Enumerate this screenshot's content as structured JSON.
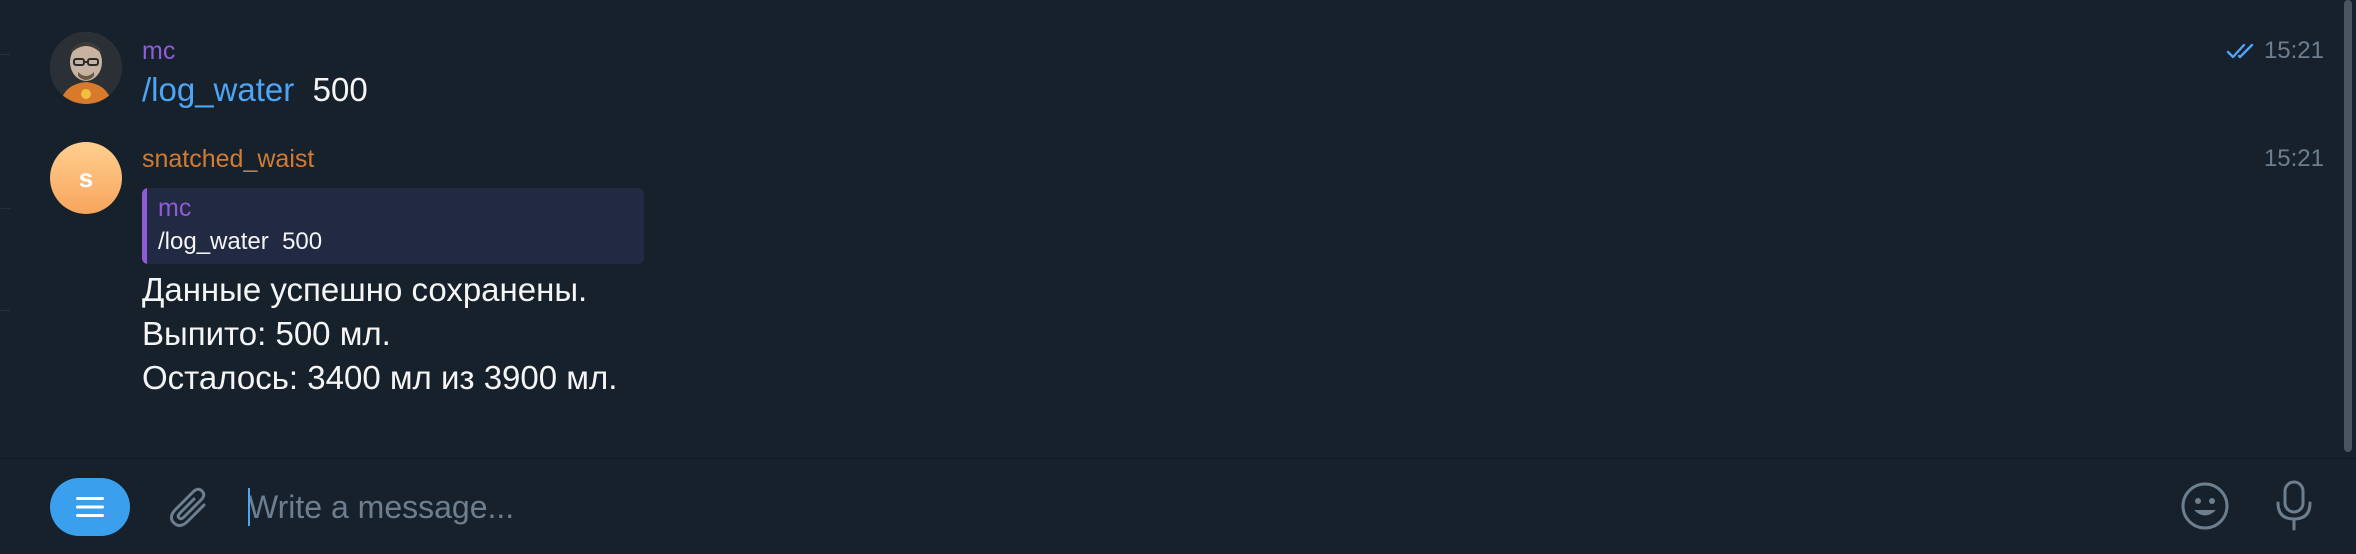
{
  "messages": [
    {
      "sender": "mc",
      "time": "15:21",
      "status": "read",
      "command": "/log_water",
      "argument": "500",
      "avatar": "photo"
    },
    {
      "sender": "snatched_waist",
      "time": "15:21",
      "avatar_letter": "s",
      "reply": {
        "sender": "mc",
        "text": "/log_water  500"
      },
      "lines": [
        "Данные успешно сохранены.",
        "Выпито: 500 мл.",
        "Осталось: 3400 мл из 3900 мл."
      ]
    }
  ],
  "composer": {
    "placeholder": "Write a message...",
    "value": "",
    "menu_icon": "menu-icon",
    "attach_icon": "paperclip-icon",
    "emoji_icon": "emoji-icon",
    "mic_icon": "microphone-icon"
  },
  "colors": {
    "background": "#17212b",
    "accent": "#3aa0ed",
    "command": "#4ea4f5",
    "sender_mc": "#8e5cd6",
    "sender_bot": "#d27c33",
    "reply_bg": "#222942",
    "muted": "#6d7f8f"
  }
}
